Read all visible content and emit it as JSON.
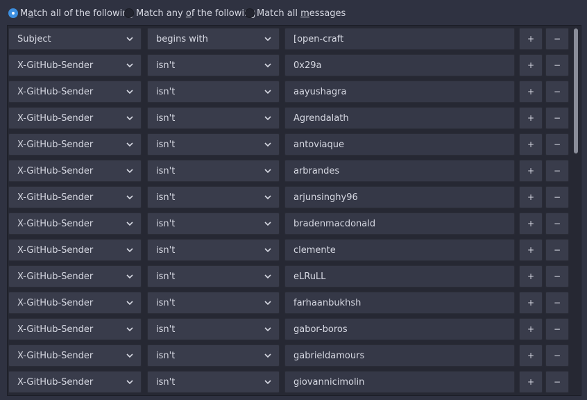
{
  "match_mode": {
    "options": [
      {
        "pre": "M",
        "ul": "a",
        "post": "tch all of the following",
        "checked": true
      },
      {
        "pre": "Match any ",
        "ul": "o",
        "post": "f the following",
        "checked": false
      },
      {
        "pre": "Match all ",
        "ul": "m",
        "post": "essages",
        "checked": false
      }
    ]
  },
  "buttons": {
    "add_label": "+",
    "remove_label": "−"
  },
  "rules": [
    {
      "field": "Subject",
      "op": "begins with",
      "value": "[open-craft"
    },
    {
      "field": "X-GitHub-Sender",
      "op": "isn't",
      "value": "0x29a"
    },
    {
      "field": "X-GitHub-Sender",
      "op": "isn't",
      "value": "aayushagra"
    },
    {
      "field": "X-GitHub-Sender",
      "op": "isn't",
      "value": "Agrendalath"
    },
    {
      "field": "X-GitHub-Sender",
      "op": "isn't",
      "value": "antoviaque"
    },
    {
      "field": "X-GitHub-Sender",
      "op": "isn't",
      "value": "arbrandes"
    },
    {
      "field": "X-GitHub-Sender",
      "op": "isn't",
      "value": "arjunsinghy96"
    },
    {
      "field": "X-GitHub-Sender",
      "op": "isn't",
      "value": "bradenmacdonald"
    },
    {
      "field": "X-GitHub-Sender",
      "op": "isn't",
      "value": "clemente"
    },
    {
      "field": "X-GitHub-Sender",
      "op": "isn't",
      "value": "eLRuLL"
    },
    {
      "field": "X-GitHub-Sender",
      "op": "isn't",
      "value": "farhaanbukhsh"
    },
    {
      "field": "X-GitHub-Sender",
      "op": "isn't",
      "value": "gabor-boros"
    },
    {
      "field": "X-GitHub-Sender",
      "op": "isn't",
      "value": "gabrieldamours"
    },
    {
      "field": "X-GitHub-Sender",
      "op": "isn't",
      "value": "giovannicimolin"
    }
  ]
}
